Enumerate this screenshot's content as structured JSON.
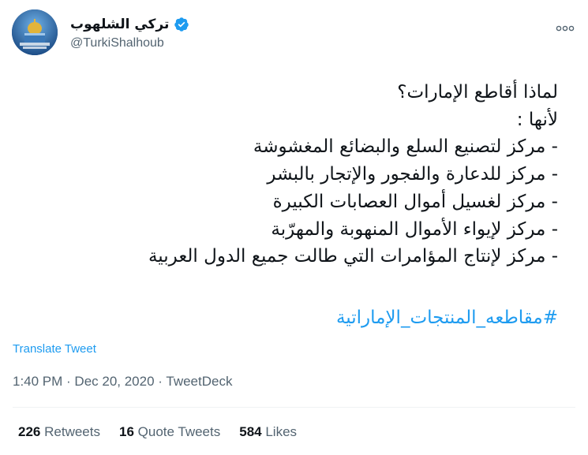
{
  "author": {
    "display_name": "تركي الشلهوب",
    "handle": "@TurkiShalhoub",
    "verified": true
  },
  "tweet": {
    "lines": [
      "لماذا أقاطع الإمارات؟",
      "لأنها :",
      "- مركز لتصنيع السلع والبضائع المغشوشة",
      "- مركز للدعارة والفجور والإتجار بالبشر",
      "- مركز لغسيل أموال العصابات الكبيرة",
      "- مركز لإيواء الأموال المنهوبة والمهرّبة",
      "- مركز لإنتاج المؤامرات التي طالت جميع الدول العربية"
    ],
    "hashtag": "#مقاطعه_المنتجات_الإماراتية"
  },
  "translate_label": "Translate Tweet",
  "meta": {
    "time": "1:40 PM",
    "sep1": " · ",
    "date": "Dec 20, 2020",
    "sep2": " · ",
    "source": "TweetDeck"
  },
  "stats": {
    "retweets_count": "226",
    "retweets_label": "Retweets",
    "quotes_count": "16",
    "quotes_label": "Quote Tweets",
    "likes_count": "584",
    "likes_label": "Likes"
  },
  "colors": {
    "link": "#1d9bf0",
    "secondary_text": "#536471",
    "primary_text": "#0f1419"
  },
  "icons": [
    "avatar-image",
    "verified-badge-icon",
    "more-options-icon"
  ]
}
